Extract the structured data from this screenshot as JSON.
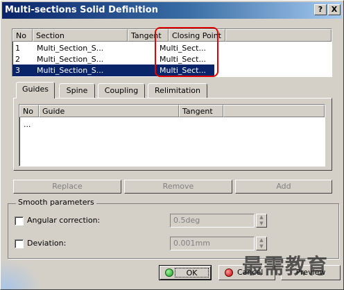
{
  "window": {
    "title": "Multi-sections Solid Definition",
    "help_label": "?",
    "close_label": "X"
  },
  "sections_table": {
    "headers": [
      "No",
      "Section",
      "Tangent",
      "Closing Point"
    ],
    "rows": [
      {
        "no": "1",
        "section": "Multi_Section_S...",
        "tangent": "",
        "closing_point": "Multi_Sect...",
        "selected": false
      },
      {
        "no": "2",
        "section": "Multi_Section_S...",
        "tangent": "",
        "closing_point": "Multi_Sect...",
        "selected": false
      },
      {
        "no": "3",
        "section": "Multi_Section_S...",
        "tangent": "",
        "closing_point": "Multi_Sect...",
        "selected": true
      }
    ],
    "highlight_color": "#e00000",
    "selection_color": "#0a246a"
  },
  "tabs": [
    {
      "label": "Guides",
      "active": true
    },
    {
      "label": "Spine",
      "active": false
    },
    {
      "label": "Coupling",
      "active": false
    },
    {
      "label": "Relimitation",
      "active": false
    }
  ],
  "guides_table": {
    "headers": [
      "No",
      "Guide",
      "Tangent"
    ],
    "placeholder_row": "..."
  },
  "action_buttons": {
    "replace": "Replace",
    "remove": "Remove",
    "add": "Add"
  },
  "smooth": {
    "legend": "Smooth parameters",
    "angular_label": "Angular correction:",
    "angular_value": "0.5deg",
    "angular_checked": false,
    "deviation_label": "Deviation:",
    "deviation_value": "0.001mm",
    "deviation_checked": false
  },
  "footer": {
    "ok": "OK",
    "cancel": "Cancel",
    "preview": "Preview",
    "ok_icon_color": "#2eb82e",
    "cancel_icon_color": "#d01010"
  },
  "watermark": "最需教育"
}
